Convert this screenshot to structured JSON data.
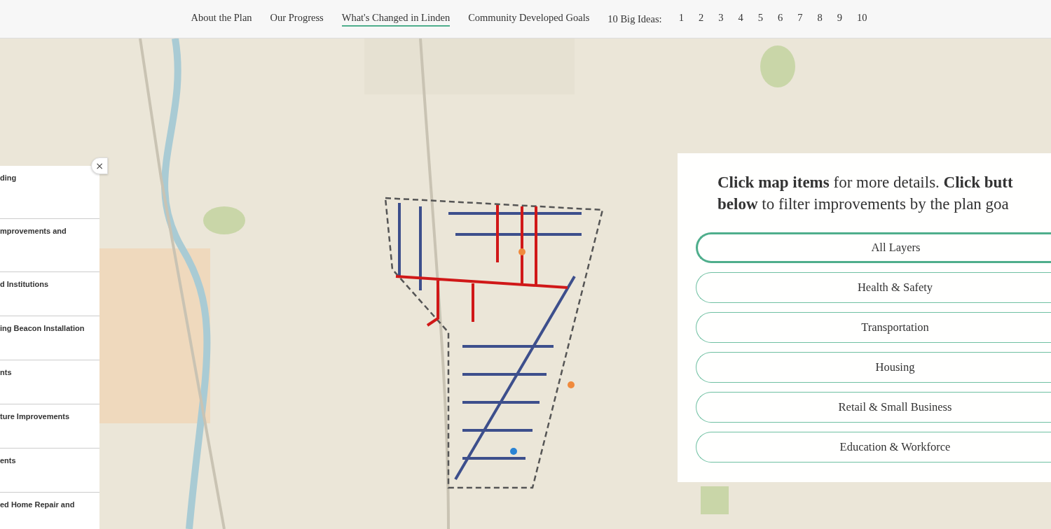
{
  "nav": {
    "links": [
      {
        "label": "About the Plan",
        "selected": false
      },
      {
        "label": "Our Progress",
        "selected": false
      },
      {
        "label": "What's Changed in Linden",
        "selected": true
      },
      {
        "label": "Community Developed Goals",
        "selected": false
      }
    ],
    "ideas_label": "10 Big Ideas:",
    "ideas": [
      "1",
      "2",
      "3",
      "4",
      "5",
      "6",
      "7",
      "8",
      "9",
      "10"
    ]
  },
  "side_panel": {
    "close": "×",
    "items": [
      "ding",
      "mprovements and",
      "d Institutions",
      "ing Beacon Installation",
      "nts",
      "ture Improvements",
      "ents",
      "ed Home Repair and"
    ]
  },
  "filter_panel": {
    "intro": "**Click map items** for more details. **Click butt**\n**below** to filter improvements by the plan goa",
    "filters": [
      {
        "label": "All Layers",
        "selected": true
      },
      {
        "label": "Health & Safety",
        "selected": false
      },
      {
        "label": "Transportation",
        "selected": false
      },
      {
        "label": "Housing",
        "selected": false
      },
      {
        "label": "Retail & Small Business",
        "selected": false
      },
      {
        "label": "Education & Workforce",
        "selected": false
      }
    ]
  }
}
